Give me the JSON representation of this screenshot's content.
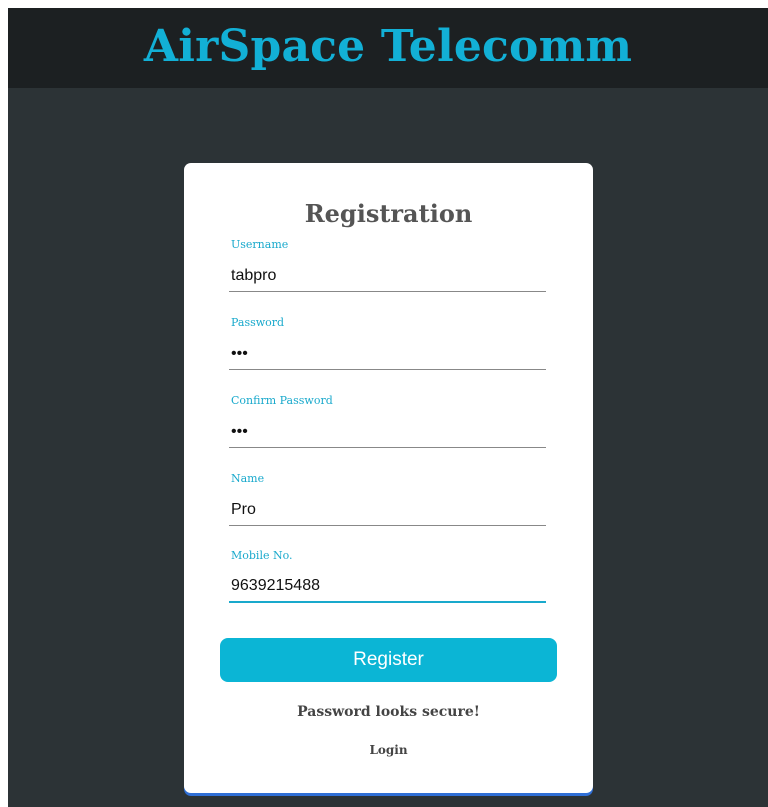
{
  "header": {
    "title": "AirSpace Telecomm"
  },
  "form": {
    "title": "Registration",
    "fields": [
      {
        "label": "Username",
        "value": "tabpro",
        "type": "text"
      },
      {
        "label": "Password",
        "value": "abc",
        "type": "password"
      },
      {
        "label": "Confirm Password",
        "value": "abc",
        "type": "password"
      },
      {
        "label": "Name",
        "value": "Pro",
        "type": "text"
      },
      {
        "label": "Mobile No.",
        "value": "9639215488",
        "type": "text"
      }
    ],
    "register_label": "Register",
    "status_message": "Password looks secure!",
    "login_label": "Login"
  },
  "colors": {
    "accent": "#0bb5d5",
    "header_background": "#1c2022",
    "page_background": "#2c3336",
    "card_background": "#ffffff"
  }
}
